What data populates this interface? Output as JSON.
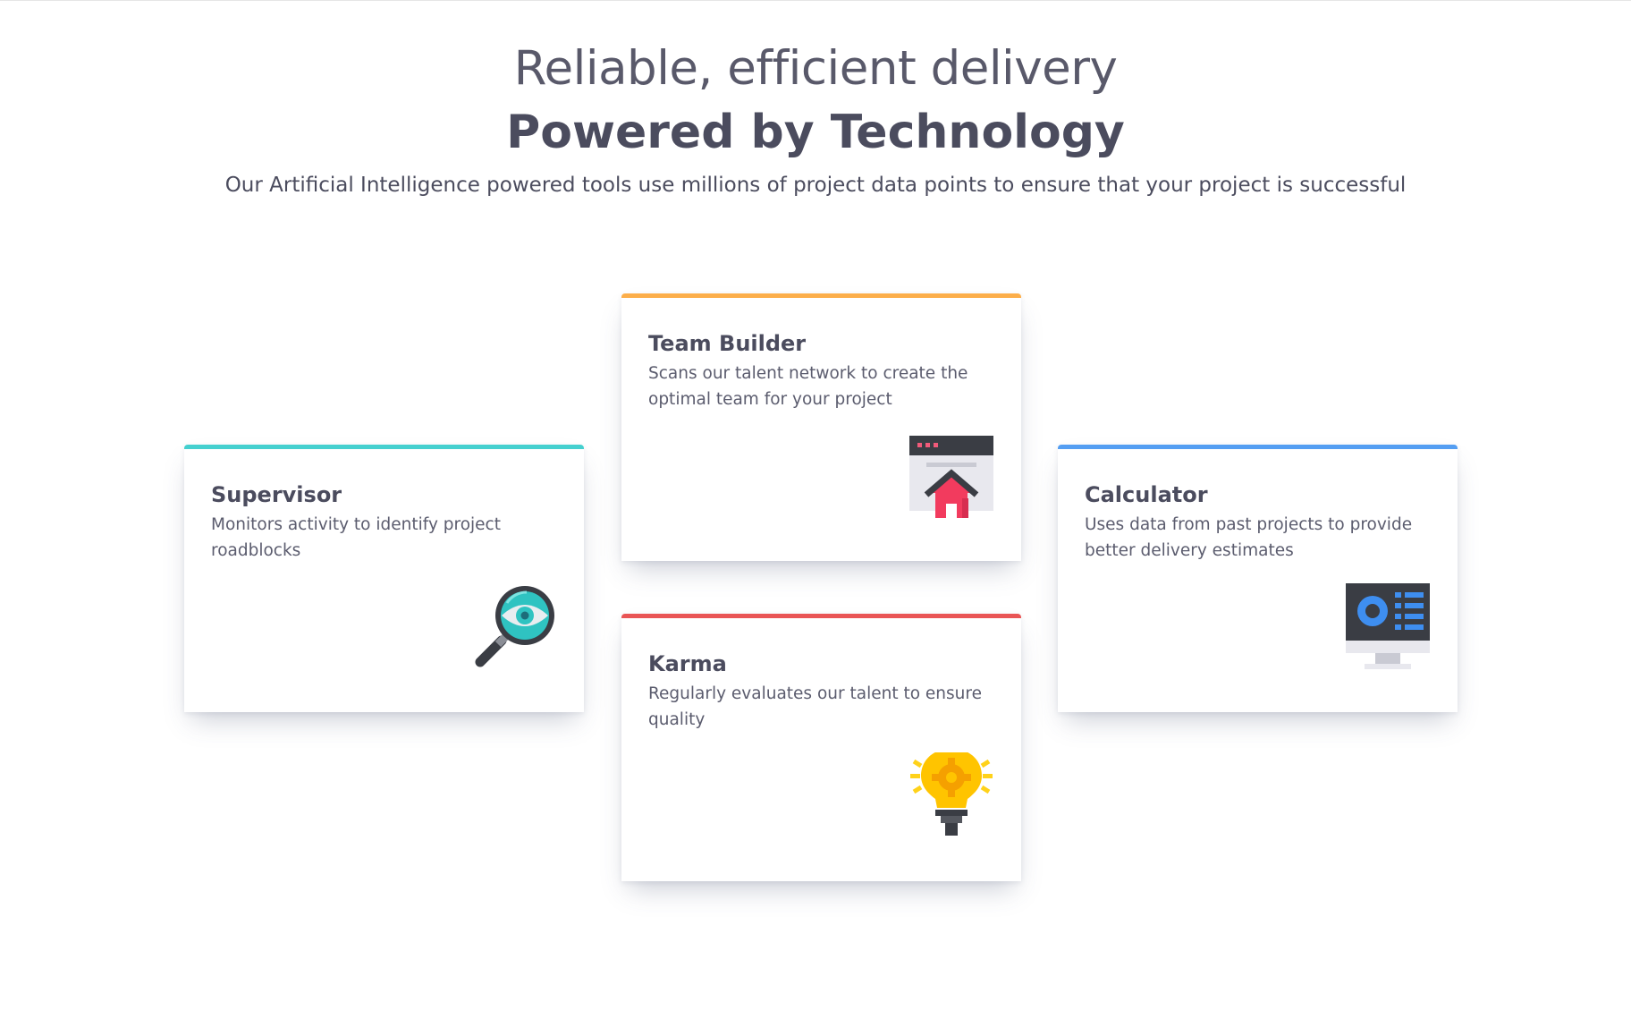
{
  "header": {
    "headline_light": "Reliable, efficient delivery",
    "headline_bold": "Powered by Technology",
    "subtitle": "Our Artificial Intelligence powered tools use millions of project data points to ensure that your project is successful"
  },
  "cards": {
    "supervisor": {
      "title": "Supervisor",
      "description": "Monitors activity to identify project roadblocks",
      "accent": "#45d0cf",
      "icon": "magnifier-eye-icon"
    },
    "team_builder": {
      "title": "Team Builder",
      "description": "Scans our talent network to create the optimal team for your project",
      "accent": "#fcae4a",
      "icon": "browser-home-icon"
    },
    "karma": {
      "title": "Karma",
      "description": "Regularly evaluates our talent to ensure quality",
      "accent": "#e95555",
      "icon": "lightbulb-gear-icon"
    },
    "calculator": {
      "title": "Calculator",
      "description": "Uses data from past projects to provide better delivery estimates",
      "accent": "#549ef2",
      "icon": "monitor-dashboard-icon"
    }
  }
}
